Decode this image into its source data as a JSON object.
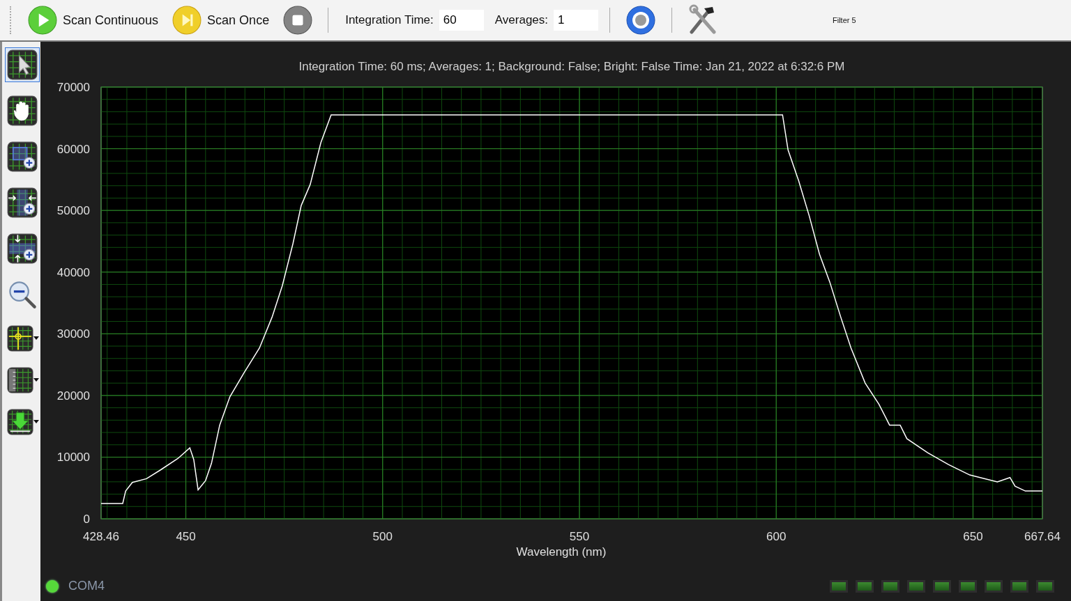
{
  "toolbar": {
    "buttons": [
      {
        "kind": "play",
        "label": "Scan Continuous",
        "disabled": false
      },
      {
        "kind": "step",
        "label": "Scan Once",
        "disabled": false
      },
      {
        "kind": "stop",
        "disabled": true
      }
    ],
    "integration_time": {
      "label": "Integration Time:",
      "value": "60"
    },
    "averages": {
      "label": "Averages:",
      "value": "1"
    },
    "filter_label": "Filter 5"
  },
  "side_tools": [
    {
      "kind": "pointer",
      "selected": true
    },
    {
      "kind": "pan",
      "selected": false
    },
    {
      "kind": "zoom-box",
      "selected": false
    },
    {
      "kind": "zoom-horizontal",
      "selected": false
    },
    {
      "kind": "zoom-vertical",
      "selected": false
    },
    {
      "kind": "zoom-out",
      "selected": false
    },
    {
      "kind": "crosshair",
      "selected": false
    },
    {
      "kind": "ruler",
      "selected": false
    },
    {
      "kind": "download",
      "selected": false
    }
  ],
  "chart_data": {
    "type": "line",
    "title": "Integration Time: 60 ms; Averages: 1; Background: False; Bright: False Time: Jan 21, 2022 at 6:32:6 PM",
    "xlabel": "Wavelength (nm)",
    "x": [
      428.46,
      433.96,
      434.7,
      436.4,
      440,
      443.5,
      448,
      451,
      452,
      453.1,
      455,
      456.5,
      458.6,
      461.2,
      464.8,
      468.7,
      471.9,
      474.5,
      477.2,
      479.3,
      481.6,
      484.3,
      486.9,
      601.6,
      603,
      605.7,
      608.4,
      611,
      613.6,
      616.4,
      619,
      622.6,
      626.1,
      628.8,
      631.5,
      633.2,
      638.5,
      643.8,
      649.2,
      656.2,
      659.4,
      660.7,
      663.3,
      667.64
    ],
    "grid": true,
    "series": [
      {
        "color": "#ffffff",
        "values": [
          2500,
          2500,
          4500,
          5900,
          6500,
          7900,
          9800,
          11500,
          9600,
          4700,
          6200,
          9000,
          15200,
          19800,
          23700,
          27700,
          32700,
          37800,
          44600,
          50800,
          54200,
          61000,
          65500,
          65500,
          59800,
          54800,
          49100,
          42900,
          38400,
          32700,
          27700,
          22000,
          18600,
          15200,
          15200,
          13000,
          10700,
          8800,
          7100,
          6000,
          6700,
          5300,
          4500,
          4500
        ]
      }
    ],
    "xlim": [
      428.46,
      667.64
    ],
    "ylim": [
      0,
      70000
    ],
    "xticks": [
      428.46,
      450,
      500,
      550,
      600,
      650,
      667.64
    ],
    "yticks": [
      0,
      10000,
      20000,
      30000,
      40000,
      50000,
      60000,
      70000
    ]
  },
  "status_bar": {
    "port": "COM4",
    "connected": true,
    "leds": [
      {
        "on": true
      },
      {
        "on": true
      },
      {
        "on": true
      },
      {
        "on": true
      },
      {
        "on": true
      },
      {
        "on": true
      },
      {
        "on": true
      },
      {
        "on": true
      },
      {
        "on": true
      }
    ]
  }
}
